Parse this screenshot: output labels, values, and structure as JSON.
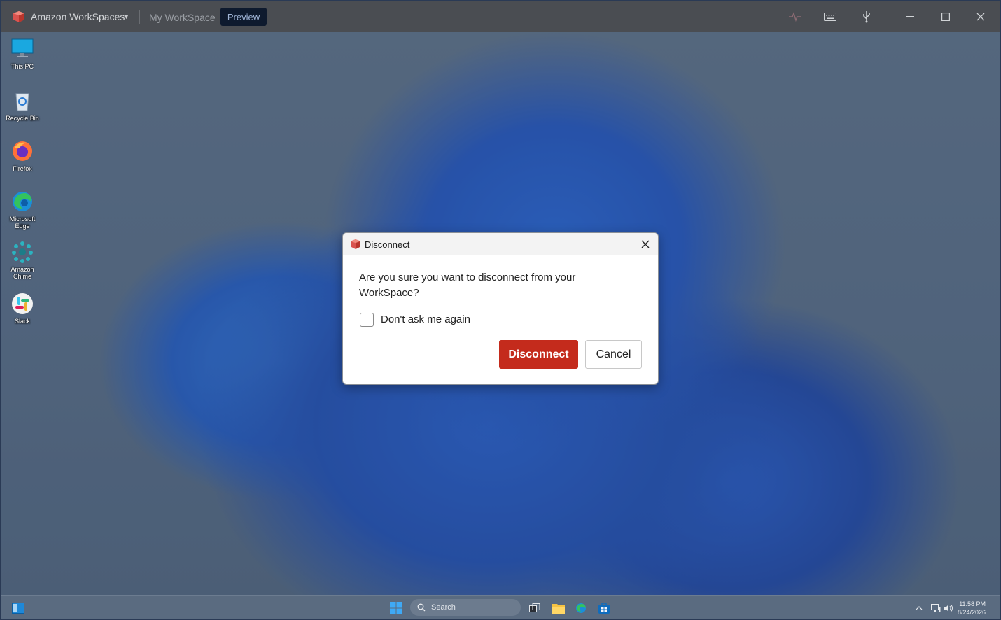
{
  "titlebar": {
    "app_title": "Amazon WorkSpaces",
    "workspace_name": "My WorkSpace",
    "preview_label": "Preview"
  },
  "desktop": {
    "icons": [
      {
        "label": "This PC",
        "icon": "monitor-icon"
      },
      {
        "label": "Recycle Bin",
        "icon": "recycle-bin-icon"
      },
      {
        "label": "Firefox",
        "icon": "firefox-icon"
      },
      {
        "label": "Microsoft Edge",
        "icon": "edge-icon"
      },
      {
        "label": "Amazon Chime",
        "icon": "chime-icon"
      },
      {
        "label": "Slack",
        "icon": "slack-icon"
      }
    ]
  },
  "dialog": {
    "title": "Disconnect",
    "message": "Are you sure you want to disconnect from your WorkSpace?",
    "checkbox_label": "Don't ask me again",
    "checkbox_checked": false,
    "primary_button": "Disconnect",
    "secondary_button": "Cancel"
  },
  "taskbar": {
    "search_placeholder": "Search",
    "time": "11:58 PM",
    "date": "8/24/2026"
  },
  "colors": {
    "primary_button": "#c42b1c",
    "preview_badge": "#0e1a2e",
    "titlebar": "#4a4d52"
  }
}
